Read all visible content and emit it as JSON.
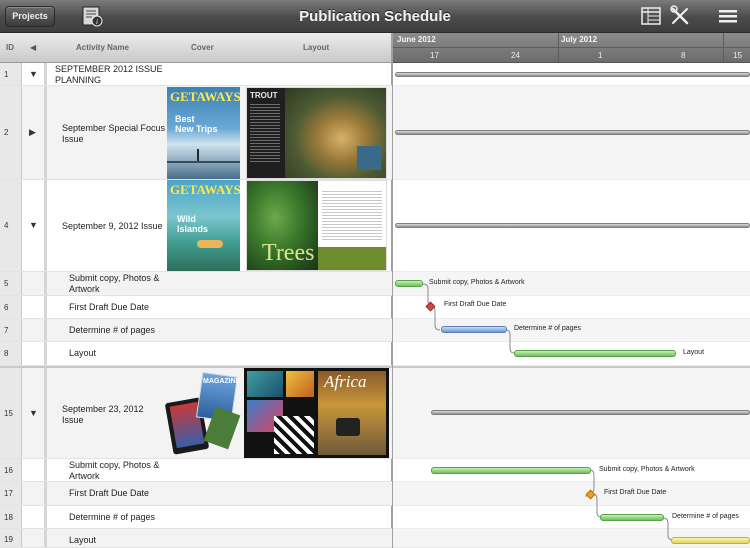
{
  "toolbar": {
    "projects_label": "Projects",
    "title": "Publication Schedule",
    "icons": [
      "document-info-icon",
      "table-view-icon",
      "tools-icon",
      "menu-icon"
    ]
  },
  "columns": {
    "id": "ID",
    "activity": "Activity Name",
    "cover": "Cover",
    "layout": "Layout"
  },
  "timeline": {
    "months": [
      "June 2012",
      "July 2012"
    ],
    "days": [
      "17",
      "24",
      "1",
      "8",
      "15"
    ]
  },
  "rows": [
    {
      "id": "1",
      "name": "SEPTEMBER 2012 ISSUE PLANNING",
      "disclosure": "expanded"
    },
    {
      "id": "2",
      "name": "September Special Focus Issue",
      "disclosure": "collapsed"
    },
    {
      "id": "4",
      "name": "September 9, 2012 Issue",
      "disclosure": "expanded"
    },
    {
      "id": "5",
      "name": "Submit copy, Photos & Artwork"
    },
    {
      "id": "6",
      "name": "First Draft Due Date"
    },
    {
      "id": "7",
      "name": "Determine # of pages"
    },
    {
      "id": "8",
      "name": "Layout"
    },
    {
      "id": "15",
      "name": "September 23, 2012 Issue",
      "disclosure": "expanded"
    },
    {
      "id": "16",
      "name": "Submit copy, Photos & Artwork"
    },
    {
      "id": "17",
      "name": "First Draft Due Date"
    },
    {
      "id": "18",
      "name": "Determine # of pages"
    },
    {
      "id": "19",
      "name": "Layout"
    }
  ],
  "covers": {
    "getaways1": {
      "brand": "GETAWAYS",
      "headline_1": "Best",
      "headline_2": "New Trips"
    },
    "trout": {
      "brand": "TROUT"
    },
    "getaways2": {
      "brand": "GETAWAYS",
      "headline_1": "Wild",
      "headline_2": "Islands"
    },
    "trees": {
      "headline": "Trees"
    },
    "magazine": {
      "brand": "MAGAZINE"
    },
    "africa": {
      "headline": "Africa"
    }
  },
  "gantt_labels": {
    "r5": "Submit copy, Photos & Artwork",
    "r6": "First Draft Due Date",
    "r7": "Determine # of pages",
    "r8": "Layout",
    "r16": "Submit copy, Photos & Artwork",
    "r17": "First Draft Due Date",
    "r18": "Determine # of pages"
  },
  "colors": {
    "task_bar": "#6fc05c",
    "pages_bar": "#6f97cf",
    "milestone_6": "#d9443a",
    "milestone_17": "#f0a020",
    "layout_19": "#e3d35a"
  }
}
